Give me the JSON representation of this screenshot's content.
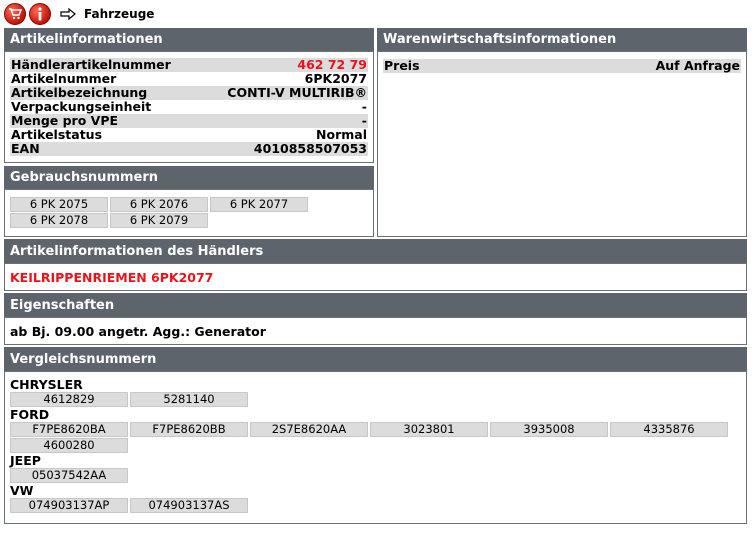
{
  "topbar": {
    "label": "Fahrzeuge"
  },
  "articleinfo": {
    "title": "Artikelinformationen",
    "rows": [
      {
        "label": "Händlerartikelnummer",
        "value": "462 72 79",
        "red": true
      },
      {
        "label": "Artikelnummer",
        "value": "6PK2077"
      },
      {
        "label": "Artikelbezeichnung",
        "value": "CONTI-V MULTIRIB®"
      },
      {
        "label": "Verpackungseinheit",
        "value": "-"
      },
      {
        "label": "Menge pro VPE",
        "value": "-"
      },
      {
        "label": "Artikelstatus",
        "value": "Normal"
      },
      {
        "label": "EAN",
        "value": "4010858507053"
      }
    ]
  },
  "warenwirtschaft": {
    "title": "Warenwirtschaftsinformationen",
    "price_label": "Preis",
    "price_value": "Auf Anfrage"
  },
  "gebrauch": {
    "title": "Gebrauchsnummern",
    "numbers": [
      "6 PK 2075",
      "6 PK 2076",
      "6 PK 2077",
      "6 PK 2078",
      "6 PK 2079"
    ]
  },
  "haendler": {
    "title": "Artikelinformationen des Händlers",
    "text": "KEILRIPPENRIEMEN 6PK2077"
  },
  "eigenschaften": {
    "title": "Eigenschaften",
    "text": "ab Bj. 09.00 angetr. Agg.: Generator"
  },
  "vergleich": {
    "title": "Vergleichsnummern",
    "makers": [
      {
        "name": "CHRYSLER",
        "numbers": [
          "4612829",
          "5281140"
        ]
      },
      {
        "name": "FORD",
        "numbers": [
          "F7PE8620BA",
          "F7PE8620BB",
          "2S7E8620AA",
          "3023801",
          "3935008",
          "4335876",
          "4600280"
        ]
      },
      {
        "name": "JEEP",
        "numbers": [
          "05037542AA"
        ]
      },
      {
        "name": "VW",
        "numbers": [
          "074903137AP",
          "074903137AS"
        ]
      }
    ]
  },
  "colors": {
    "header_bg": "#5d646b",
    "accent_red": "#e8141b",
    "row_alt": "#dcdcdc"
  }
}
